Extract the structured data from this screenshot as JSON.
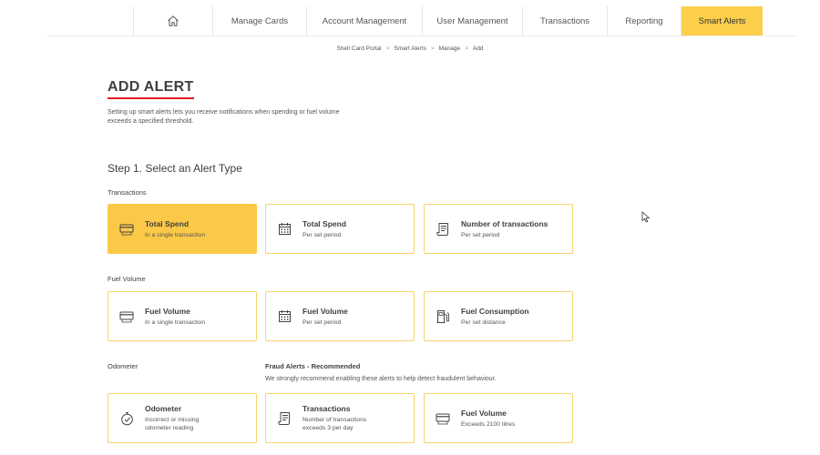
{
  "nav": {
    "items": [
      {
        "label": "Manage Cards"
      },
      {
        "label": "Account Management"
      },
      {
        "label": "User Management"
      },
      {
        "label": "Transactions"
      },
      {
        "label": "Reporting"
      },
      {
        "label": "Smart Alerts"
      }
    ],
    "active_index": 5,
    "active_color": "#fbcf4a"
  },
  "breadcrumb": [
    "Shell Card Portal",
    "Smart Alerts",
    "Manage",
    "Add"
  ],
  "page": {
    "title": "ADD ALERT",
    "intro": "Setting up smart alerts lets you receive notifications when spending or fuel volume exceeds a specified threshold.",
    "step_title": "Step 1. Select an Alert Type"
  },
  "sections": {
    "transactions": {
      "label": "Transactions",
      "cards": [
        {
          "title": "Total Spend",
          "subtitle": "In a single transaction",
          "icon": "card-icon",
          "selected": true
        },
        {
          "title": "Total Spend",
          "subtitle": "Per set period",
          "icon": "calendar-icon",
          "selected": false
        },
        {
          "title": "Number of transactions",
          "subtitle": "Per set period",
          "icon": "receipt-icon",
          "selected": false
        }
      ]
    },
    "fuel_volume": {
      "label": "Fuel Volume",
      "cards": [
        {
          "title": "Fuel Volume",
          "subtitle": "In a single transaction",
          "icon": "card-icon"
        },
        {
          "title": "Fuel Volume",
          "subtitle": "Per set period",
          "icon": "calendar-icon"
        },
        {
          "title": "Fuel Consumption",
          "subtitle": "Per set distance",
          "icon": "fuel-pump-icon"
        }
      ]
    },
    "odometer": {
      "label": "Odometer",
      "cards": [
        {
          "title": "Odometer",
          "subtitle_line1": "Incorrect or missing",
          "subtitle_line2": "odometer reading",
          "icon": "stopwatch-icon"
        }
      ]
    },
    "fraud": {
      "label": "Fraud Alerts - Recommended",
      "description": "We strongly recommend enabling these alerts to help detect fraudulent behaviour.",
      "cards": [
        {
          "title": "Transactions",
          "subtitle_line1": "Number of transactions",
          "subtitle_line2": "exceeds 3 per day",
          "icon": "receipt-icon"
        },
        {
          "title": "Fuel Volume",
          "subtitle": "Exceeds 2100 litres",
          "icon": "card-icon"
        }
      ]
    }
  },
  "colors": {
    "accent_yellow": "#fbc947",
    "card_border": "#f6d36b",
    "title_underline": "#dd1d21"
  }
}
